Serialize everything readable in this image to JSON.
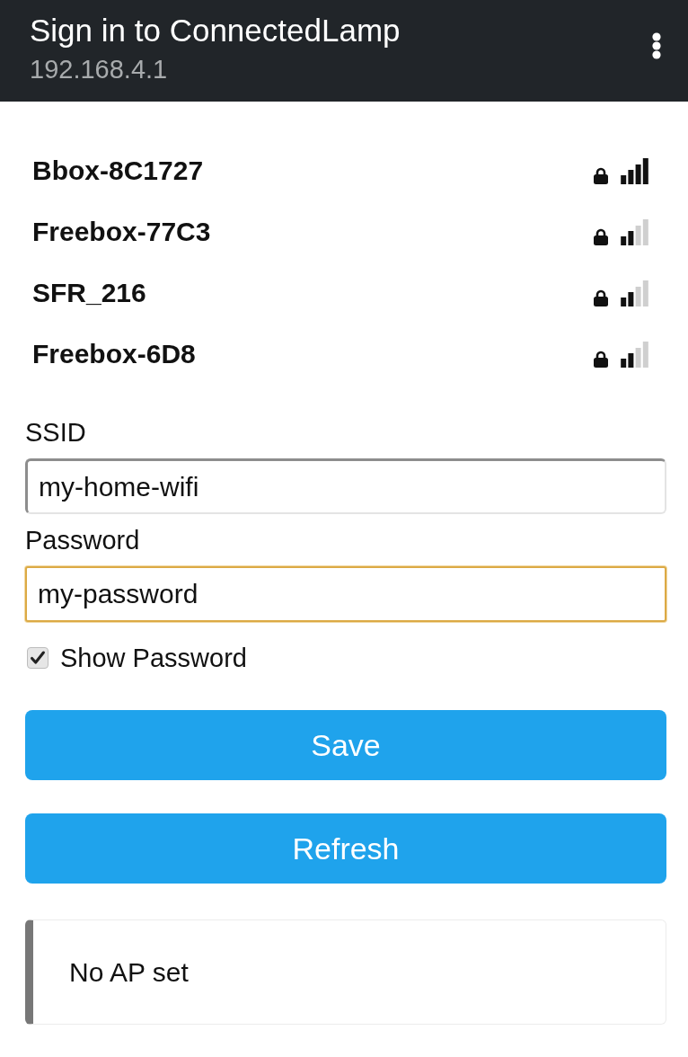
{
  "header": {
    "title": "Sign in to ConnectedLamp",
    "subtitle": "192.168.4.1"
  },
  "networks": [
    {
      "name": "Bbox-8C1727",
      "locked": true,
      "strong_signal": true
    },
    {
      "name": "Freebox-77C3",
      "locked": true,
      "strong_signal": false
    },
    {
      "name": "SFR_216",
      "locked": true,
      "strong_signal": false
    },
    {
      "name": "Freebox-6D8",
      "locked": true,
      "strong_signal": false
    }
  ],
  "fields": [
    {
      "label": "SSID",
      "value": "my-home-wifi",
      "focused": false
    },
    {
      "label": "Password",
      "value": "my-password",
      "focused": true
    }
  ],
  "show_password": {
    "label": "Show Password",
    "checked": true
  },
  "buttons": [
    {
      "label": "Save"
    },
    {
      "label": "Refresh"
    }
  ],
  "message": "No AP set"
}
